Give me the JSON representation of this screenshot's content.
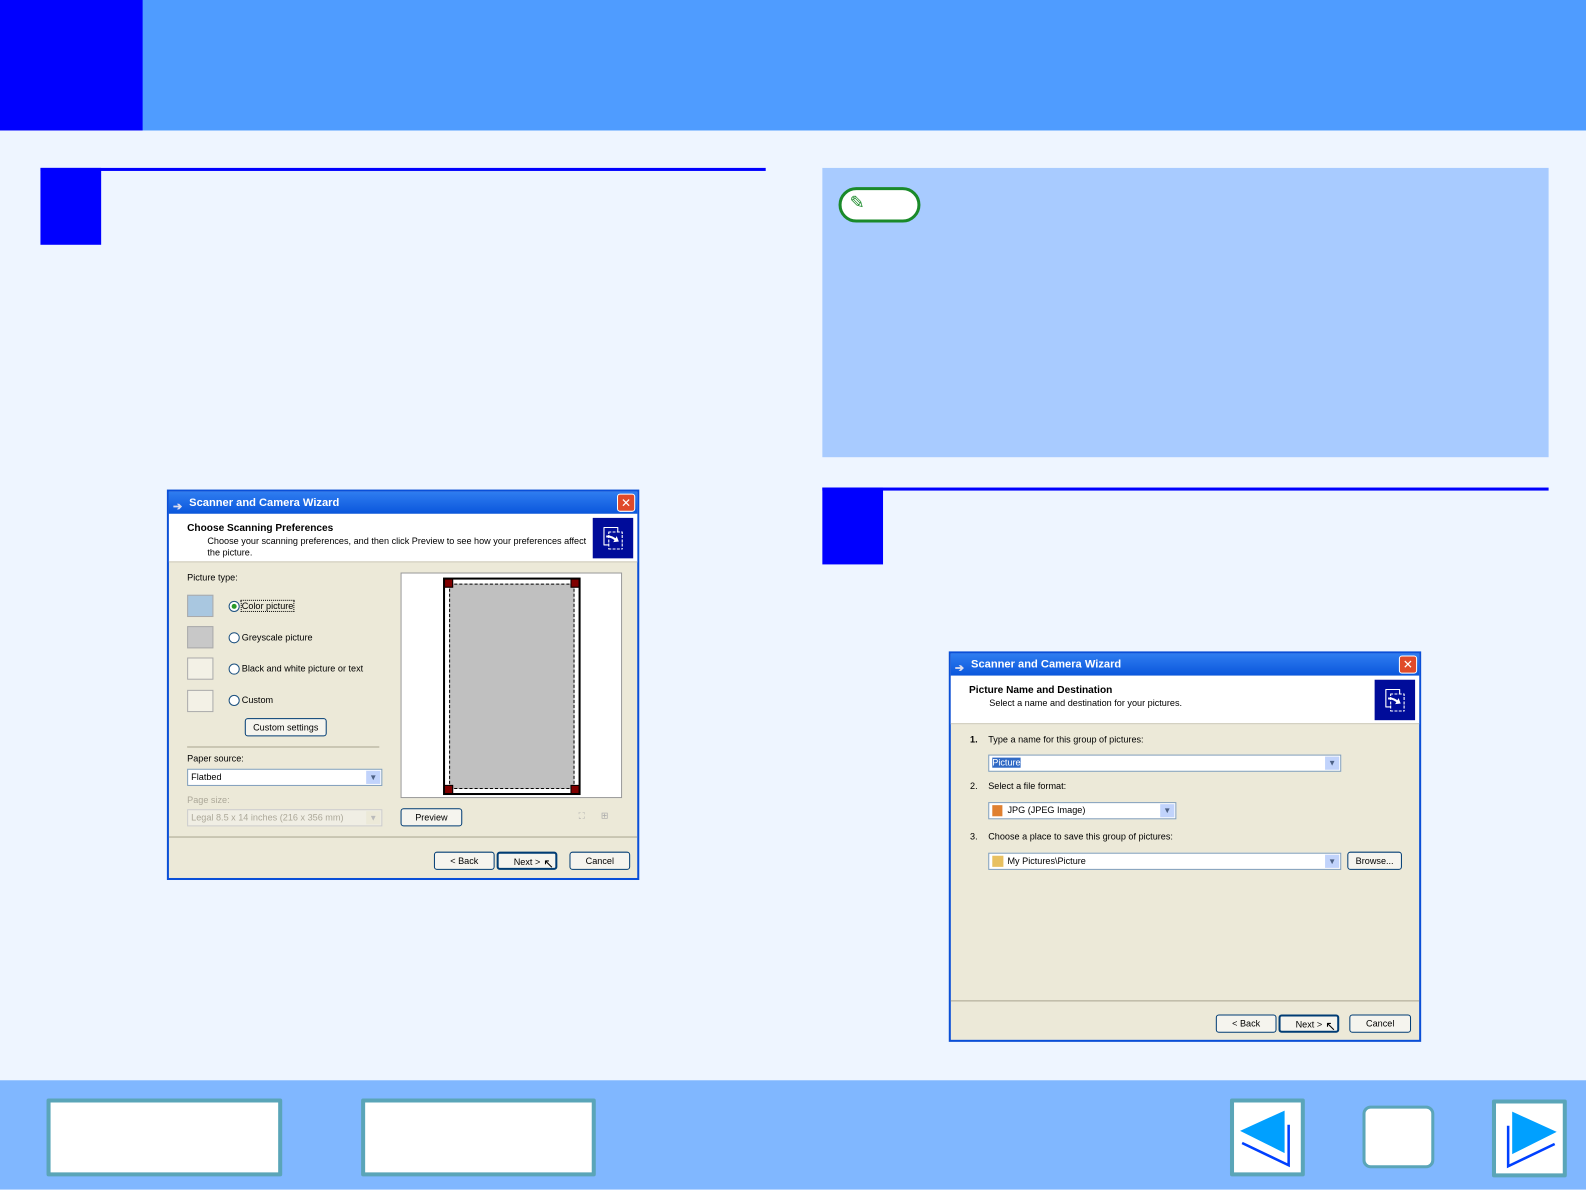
{
  "colors": {
    "header": "#4f9cff",
    "accent": "#0000ff",
    "note_bg": "#a8cbff",
    "footer": "#80b7ff",
    "nav_border": "#5aa5b8",
    "arrow": "#00a0ff"
  },
  "note": {
    "icon": "pencil-icon"
  },
  "dialog1": {
    "title": "Scanner and Camera Wizard",
    "heading": "Choose Scanning Preferences",
    "subheading": "Choose your scanning preferences, and then click Preview to see how your preferences affect the picture.",
    "picture_type_label": "Picture type:",
    "options": [
      {
        "label": "Color picture",
        "selected": true,
        "icon": "color-picture-icon"
      },
      {
        "label": "Greyscale picture",
        "selected": false,
        "icon": "greyscale-picture-icon"
      },
      {
        "label": "Black and white picture or text",
        "selected": false,
        "icon": "bw-picture-icon"
      },
      {
        "label": "Custom",
        "selected": false,
        "icon": "custom-icon"
      }
    ],
    "custom_settings": "Custom settings",
    "paper_source_label": "Paper source:",
    "paper_source": "Flatbed",
    "page_size_label": "Page size:",
    "page_size": "Legal 8.5 x 14 inches (216 x 356 mm)",
    "preview": "Preview",
    "back": "< Back",
    "next": "Next >",
    "cancel": "Cancel"
  },
  "dialog2": {
    "title": "Scanner and Camera Wizard",
    "heading": "Picture Name and Destination",
    "subheading": "Select a name and destination for your pictures.",
    "step1_num": "1.",
    "step1": "Type a name for this group of pictures:",
    "name_value": "Picture",
    "step2_num": "2.",
    "step2": "Select a file format:",
    "format_value": "JPG (JPEG Image)",
    "step3_num": "3.",
    "step3": "Choose a place to save this group of pictures:",
    "place_value": "My Pictures\\Picture",
    "browse": "Browse...",
    "back": "< Back",
    "next": "Next >",
    "cancel": "Cancel"
  },
  "footer": {
    "prev_icon": "arrow-left-icon",
    "next_icon": "arrow-right-icon"
  }
}
